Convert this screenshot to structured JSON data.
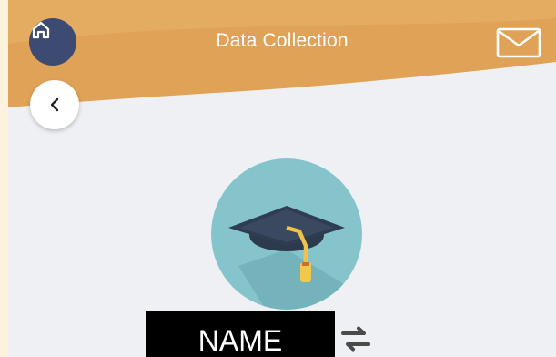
{
  "header": {
    "title": "Data Collection",
    "home_icon": "home-icon",
    "mail_icon": "mail-icon",
    "accent_color": "#dfa256"
  },
  "nav": {
    "back_icon": "chevron-left-icon"
  },
  "profile": {
    "avatar_icon": "graduation-cap-icon",
    "avatar_color": "#86c4cc",
    "name_label": "NAME",
    "swap_icon": "swap-arrows-icon"
  }
}
